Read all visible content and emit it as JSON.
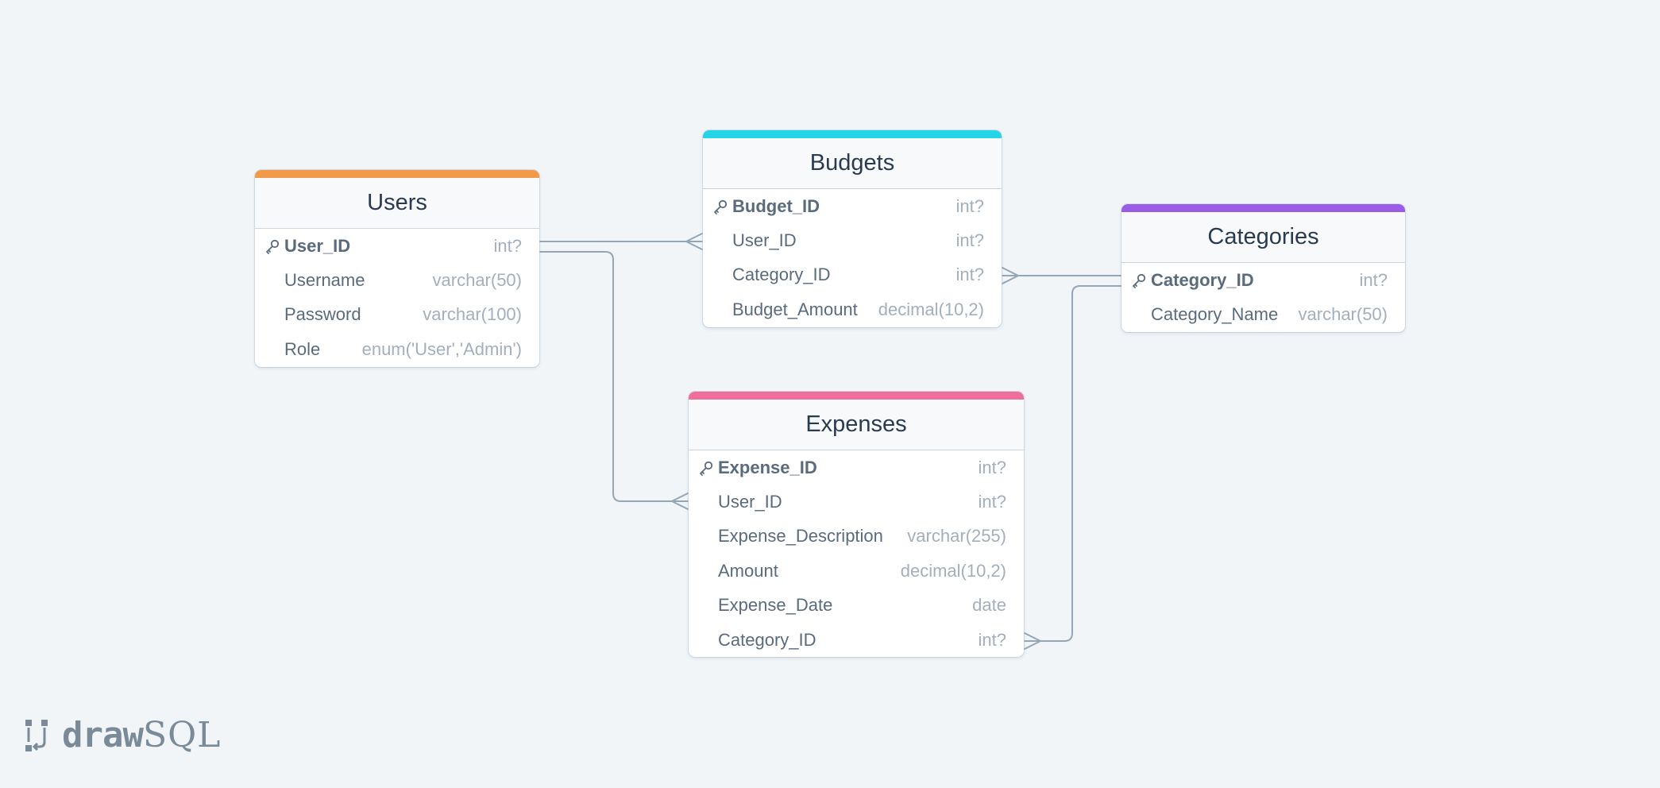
{
  "app": {
    "logo_bold": "draw",
    "logo_light": "SQL"
  },
  "colors": {
    "background": "#f1f5f8",
    "connector": "#94a6b8",
    "users_accent": "#f2994a",
    "budgets_accent": "#26d4e8",
    "categories_accent": "#9b5de5",
    "expenses_accent": "#ef6f9a"
  },
  "tables": {
    "users": {
      "title": "Users",
      "columns": [
        {
          "name": "User_ID",
          "type": "int?",
          "primary_key": true
        },
        {
          "name": "Username",
          "type": "varchar(50)",
          "primary_key": false
        },
        {
          "name": "Password",
          "type": "varchar(100)",
          "primary_key": false
        },
        {
          "name": "Role",
          "type": "enum('User','Admin')",
          "primary_key": false
        }
      ]
    },
    "budgets": {
      "title": "Budgets",
      "columns": [
        {
          "name": "Budget_ID",
          "type": "int?",
          "primary_key": true
        },
        {
          "name": "User_ID",
          "type": "int?",
          "primary_key": false
        },
        {
          "name": "Category_ID",
          "type": "int?",
          "primary_key": false
        },
        {
          "name": "Budget_Amount",
          "type": "decimal(10,2)",
          "primary_key": false
        }
      ]
    },
    "categories": {
      "title": "Categories",
      "columns": [
        {
          "name": "Category_ID",
          "type": "int?",
          "primary_key": true
        },
        {
          "name": "Category_Name",
          "type": "varchar(50)",
          "primary_key": false
        }
      ]
    },
    "expenses": {
      "title": "Expenses",
      "columns": [
        {
          "name": "Expense_ID",
          "type": "int?",
          "primary_key": true
        },
        {
          "name": "User_ID",
          "type": "int?",
          "primary_key": false
        },
        {
          "name": "Expense_Description",
          "type": "varchar(255)",
          "primary_key": false
        },
        {
          "name": "Amount",
          "type": "decimal(10,2)",
          "primary_key": false
        },
        {
          "name": "Expense_Date",
          "type": "date",
          "primary_key": false
        },
        {
          "name": "Category_ID",
          "type": "int?",
          "primary_key": false
        }
      ]
    }
  },
  "relationships": [
    {
      "from": "Users.User_ID",
      "to": "Budgets.User_ID",
      "cardinality": "one-to-many"
    },
    {
      "from": "Users.User_ID",
      "to": "Expenses.User_ID",
      "cardinality": "one-to-many"
    },
    {
      "from": "Categories.Category_ID",
      "to": "Budgets.Category_ID",
      "cardinality": "one-to-many"
    },
    {
      "from": "Categories.Category_ID",
      "to": "Expenses.Category_ID",
      "cardinality": "one-to-many"
    }
  ]
}
